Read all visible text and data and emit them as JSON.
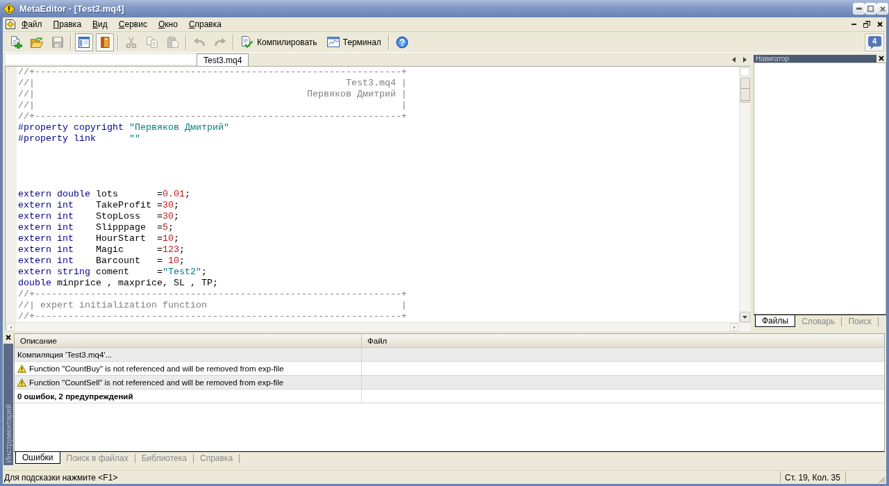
{
  "window": {
    "title": "MetaEditor - [Test3.mq4]"
  },
  "menu": [
    "Файл",
    "Правка",
    "Вид",
    "Сервис",
    "Окно",
    "Справка"
  ],
  "toolbar": {
    "groups": [
      [
        {
          "disabled": false,
          "on": false
        },
        {
          "disabled": false,
          "on": false
        },
        {
          "disabled": true,
          "on": false
        }
      ],
      [
        {
          "disabled": false,
          "on": true
        },
        {
          "disabled": false,
          "on": true
        }
      ],
      [
        {
          "disabled": true,
          "on": false
        },
        {
          "disabled": true,
          "on": false
        },
        {
          "disabled": true,
          "on": false
        }
      ],
      [
        {
          "disabled": true,
          "on": false
        },
        {
          "disabled": true,
          "on": false
        }
      ],
      [
        {
          "label": "Компилировать",
          "disabled": false,
          "on": false
        },
        {
          "label": "Терминал",
          "disabled": false,
          "on": false
        }
      ],
      [
        {
          "disabled": false,
          "on": false
        }
      ]
    ],
    "messages": "4"
  },
  "document_tabs": [
    {
      "label": "Test3.mq4",
      "selected": true
    }
  ],
  "editor": {
    "lines": [
      {
        "kind": "code",
        "tokens": [
          {
            "kind": "comment",
            "text": "//+------------------------------------------------------------------+"
          }
        ]
      },
      {
        "kind": "code",
        "tokens": [
          {
            "kind": "comment",
            "text": "//|                                                        Test3.mq4 |"
          }
        ]
      },
      {
        "kind": "code",
        "tokens": [
          {
            "kind": "comment",
            "text": "//|                                                 Первяков Дмитрий |"
          }
        ]
      },
      {
        "kind": "code",
        "tokens": [
          {
            "kind": "comment",
            "text": "//|                                                                  |"
          }
        ]
      },
      {
        "kind": "code",
        "tokens": [
          {
            "kind": "comment",
            "text": "//+------------------------------------------------------------------+"
          }
        ]
      },
      {
        "kind": "code",
        "tokens": [
          {
            "kind": "keyword",
            "text": "#property"
          },
          {
            "kind": "keyword",
            "text": " copyright"
          },
          {
            "kind": "string",
            "text": " \"Первяков Дмитрий\""
          }
        ]
      },
      {
        "kind": "code",
        "tokens": [
          {
            "kind": "keyword",
            "text": "#property"
          },
          {
            "kind": "keyword",
            "text": " link"
          },
          {
            "kind": "string",
            "text": "      \"\""
          }
        ]
      },
      {
        "kind": "blank"
      },
      {
        "kind": "blank"
      },
      {
        "kind": "blank"
      },
      {
        "kind": "blank"
      },
      {
        "kind": "code",
        "tokens": [
          {
            "kind": "keyword",
            "text": "extern"
          },
          {
            "kind": "keyword",
            "text": " double"
          },
          {
            "kind": "plain",
            "text": " lots       ="
          },
          {
            "kind": "number",
            "text": "0.01"
          },
          {
            "kind": "plain",
            "text": ";"
          }
        ]
      },
      {
        "kind": "code",
        "tokens": [
          {
            "kind": "keyword",
            "text": "extern"
          },
          {
            "kind": "keyword",
            "text": " int"
          },
          {
            "kind": "plain",
            "text": "    TakeProfit ="
          },
          {
            "kind": "number",
            "text": "30"
          },
          {
            "kind": "plain",
            "text": ";"
          }
        ]
      },
      {
        "kind": "code",
        "tokens": [
          {
            "kind": "keyword",
            "text": "extern"
          },
          {
            "kind": "keyword",
            "text": " int"
          },
          {
            "kind": "plain",
            "text": "    StopLoss   ="
          },
          {
            "kind": "number",
            "text": "30"
          },
          {
            "kind": "plain",
            "text": ";"
          }
        ]
      },
      {
        "kind": "code",
        "tokens": [
          {
            "kind": "keyword",
            "text": "extern"
          },
          {
            "kind": "keyword",
            "text": " int"
          },
          {
            "kind": "plain",
            "text": "    Slipppage  ="
          },
          {
            "kind": "number",
            "text": "5"
          },
          {
            "kind": "plain",
            "text": ";"
          }
        ]
      },
      {
        "kind": "code",
        "tokens": [
          {
            "kind": "keyword",
            "text": "extern"
          },
          {
            "kind": "keyword",
            "text": " int"
          },
          {
            "kind": "plain",
            "text": "    HourStart  ="
          },
          {
            "kind": "number",
            "text": "10"
          },
          {
            "kind": "plain",
            "text": ";"
          }
        ]
      },
      {
        "kind": "code",
        "tokens": [
          {
            "kind": "keyword",
            "text": "extern"
          },
          {
            "kind": "keyword",
            "text": " int"
          },
          {
            "kind": "plain",
            "text": "    Magic      ="
          },
          {
            "kind": "number",
            "text": "123"
          },
          {
            "kind": "plain",
            "text": ";"
          }
        ]
      },
      {
        "kind": "code",
        "tokens": [
          {
            "kind": "keyword",
            "text": "extern"
          },
          {
            "kind": "keyword",
            "text": " int"
          },
          {
            "kind": "plain",
            "text": "    Barcount   = "
          },
          {
            "kind": "number",
            "text": "10"
          },
          {
            "kind": "plain",
            "text": ";"
          }
        ]
      },
      {
        "kind": "code",
        "tokens": [
          {
            "kind": "keyword",
            "text": "extern"
          },
          {
            "kind": "keyword",
            "text": " string"
          },
          {
            "kind": "plain",
            "text": " coment     ="
          },
          {
            "kind": "string",
            "text": "\"Test2\""
          },
          {
            "kind": "plain",
            "text": ";"
          }
        ]
      },
      {
        "kind": "code",
        "tokens": [
          {
            "kind": "keyword",
            "text": "double"
          },
          {
            "kind": "plain",
            "text": " minprice , maxprice, SL , TP;"
          }
        ]
      },
      {
        "kind": "code",
        "tokens": [
          {
            "kind": "comment",
            "text": "//+------------------------------------------------------------------+"
          }
        ]
      },
      {
        "kind": "code",
        "tokens": [
          {
            "kind": "comment",
            "text": "//| expert initialization function                                   |"
          }
        ]
      },
      {
        "kind": "code",
        "tokens": [
          {
            "kind": "comment",
            "text": "//+------------------------------------------------------------------+"
          }
        ]
      }
    ]
  },
  "navigator": {
    "title": "Навигатор",
    "tabs": [
      {
        "label": "Файлы",
        "selected": true
      },
      {
        "label": "Словарь",
        "selected": false
      },
      {
        "label": "Поиск",
        "selected": false
      }
    ]
  },
  "toolbox": {
    "title": "Инструментарий",
    "columns": [
      "Описание",
      "Файл"
    ],
    "rows": [
      {
        "kind": "info",
        "description": "Компиляция 'Test3.mq4'..."
      },
      {
        "kind": "warning",
        "description": "Function \"CountBuy\" is not referenced and will be removed from exp-file"
      },
      {
        "kind": "warning",
        "description": "Function \"CountSell\" is not referenced and will be removed from exp-file"
      },
      {
        "kind": "summary",
        "description": "0 ошибок, 2 предупреждений"
      }
    ],
    "tabs": [
      {
        "label": "Ошибки",
        "selected": true
      },
      {
        "label": "Поиск в файлах",
        "selected": false
      },
      {
        "label": "Библиотека",
        "selected": false
      },
      {
        "label": "Справка",
        "selected": false
      }
    ]
  },
  "status_bar": {
    "hint": "Для подсказки нажмите <F1>",
    "position": "Ст. 19, Кол. 35"
  }
}
